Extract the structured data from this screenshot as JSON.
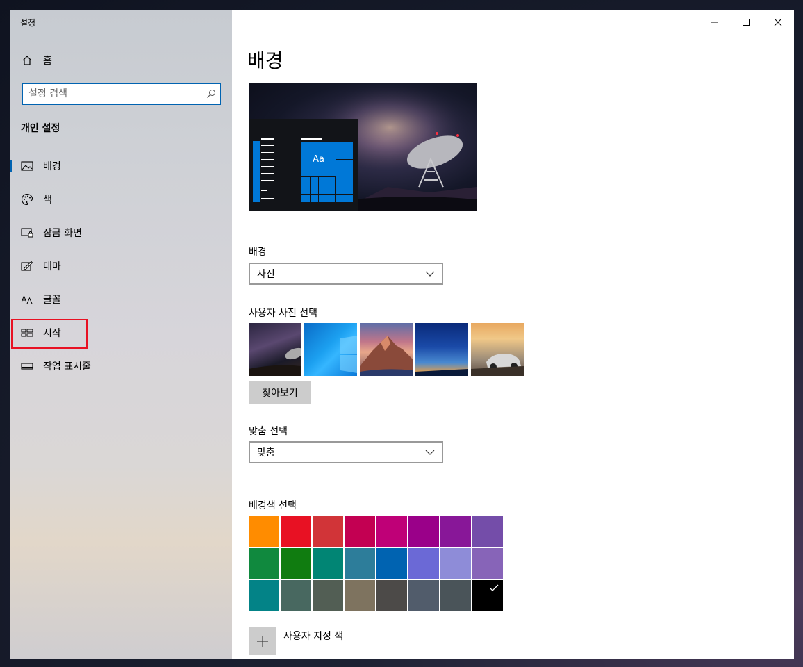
{
  "window": {
    "app_title": "설정"
  },
  "sidebar": {
    "home_label": "홈",
    "search_placeholder": "설정 검색",
    "section_title": "개인 설정",
    "items": [
      {
        "label": "배경",
        "icon": "picture-icon"
      },
      {
        "label": "색",
        "icon": "palette-icon"
      },
      {
        "label": "잠금 화면",
        "icon": "lock-screen-icon"
      },
      {
        "label": "테마",
        "icon": "theme-icon"
      },
      {
        "label": "글꼴",
        "icon": "font-icon"
      },
      {
        "label": "시작",
        "icon": "start-icon"
      },
      {
        "label": "작업 표시줄",
        "icon": "taskbar-icon"
      }
    ]
  },
  "main": {
    "page_title": "배경",
    "preview_tile_text": "Aa",
    "background_label": "배경",
    "background_value": "사진",
    "choose_picture_label": "사용자 사진 선택",
    "browse_label": "찾아보기",
    "fit_label": "맞춤 선택",
    "fit_value": "맞춤",
    "color_label": "배경색 선택",
    "custom_color_label": "사용자 지정 색",
    "colors": [
      [
        "#ff8c00",
        "#e81123",
        "#d13438",
        "#c30052",
        "#bf0077",
        "#9a0089",
        "#881798",
        "#744da9"
      ],
      [
        "#10893e",
        "#107c10",
        "#018574",
        "#2d7d9a",
        "#0063b1",
        "#6b69d6",
        "#8e8cd8",
        "#8764b8"
      ],
      [
        "#038387",
        "#486860",
        "#525e54",
        "#7e735f",
        "#4c4a48",
        "#515c6b",
        "#4a5459",
        "#000000"
      ]
    ],
    "selected_color": "#000000"
  },
  "accent_color": "#0078d7"
}
